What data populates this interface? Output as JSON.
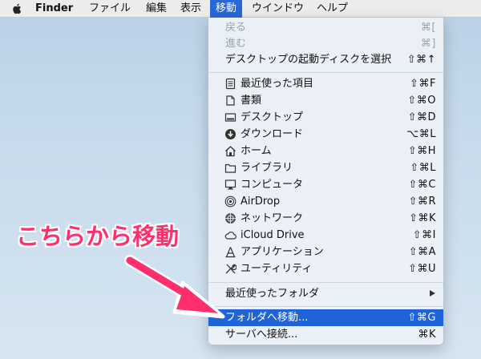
{
  "menubar": {
    "app": "Finder",
    "items": [
      "ファイル",
      "編集",
      "表示",
      "移動",
      "ウインドウ",
      "ヘルプ"
    ],
    "active_index": 3
  },
  "menu": {
    "items": [
      {
        "label": "戻る",
        "shortcut": "⌘[",
        "disabled": true
      },
      {
        "label": "進む",
        "shortcut": "⌘]",
        "disabled": true
      },
      {
        "label": "デスクトップの起動ディスクを選択",
        "shortcut": "⇧⌘↑"
      },
      {
        "label": "最近使った項目",
        "shortcut": "⇧⌘F",
        "icon": "recents-icon"
      },
      {
        "label": "書類",
        "shortcut": "⇧⌘O",
        "icon": "documents-icon"
      },
      {
        "label": "デスクトップ",
        "shortcut": "⇧⌘D",
        "icon": "desktop-icon"
      },
      {
        "label": "ダウンロード",
        "shortcut": "⌥⌘L",
        "icon": "downloads-icon"
      },
      {
        "label": "ホーム",
        "shortcut": "⇧⌘H",
        "icon": "home-icon"
      },
      {
        "label": "ライブラリ",
        "shortcut": "⇧⌘L",
        "icon": "folder-icon"
      },
      {
        "label": "コンピュータ",
        "shortcut": "⇧⌘C",
        "icon": "computer-icon"
      },
      {
        "label": "AirDrop",
        "shortcut": "⇧⌘R",
        "icon": "airdrop-icon"
      },
      {
        "label": "ネットワーク",
        "shortcut": "⇧⌘K",
        "icon": "network-icon"
      },
      {
        "label": "iCloud Drive",
        "shortcut": "⇧⌘I",
        "icon": "icloud-icon"
      },
      {
        "label": "アプリケーション",
        "shortcut": "⇧⌘A",
        "icon": "applications-icon"
      },
      {
        "label": "ユーティリティ",
        "shortcut": "⇧⌘U",
        "icon": "utilities-icon"
      },
      {
        "label": "最近使ったフォルダ",
        "submenu": true
      },
      {
        "label": "フォルダへ移動...",
        "shortcut": "⇧⌘G",
        "highlighted": true
      },
      {
        "label": "サーバへ接続...",
        "shortcut": "⌘K"
      }
    ]
  },
  "annotation": {
    "text": "こちらから移動",
    "color": "#ff2f6e"
  },
  "colors": {
    "accent": "#1e63d8",
    "menubar_bg": "#ececec"
  }
}
